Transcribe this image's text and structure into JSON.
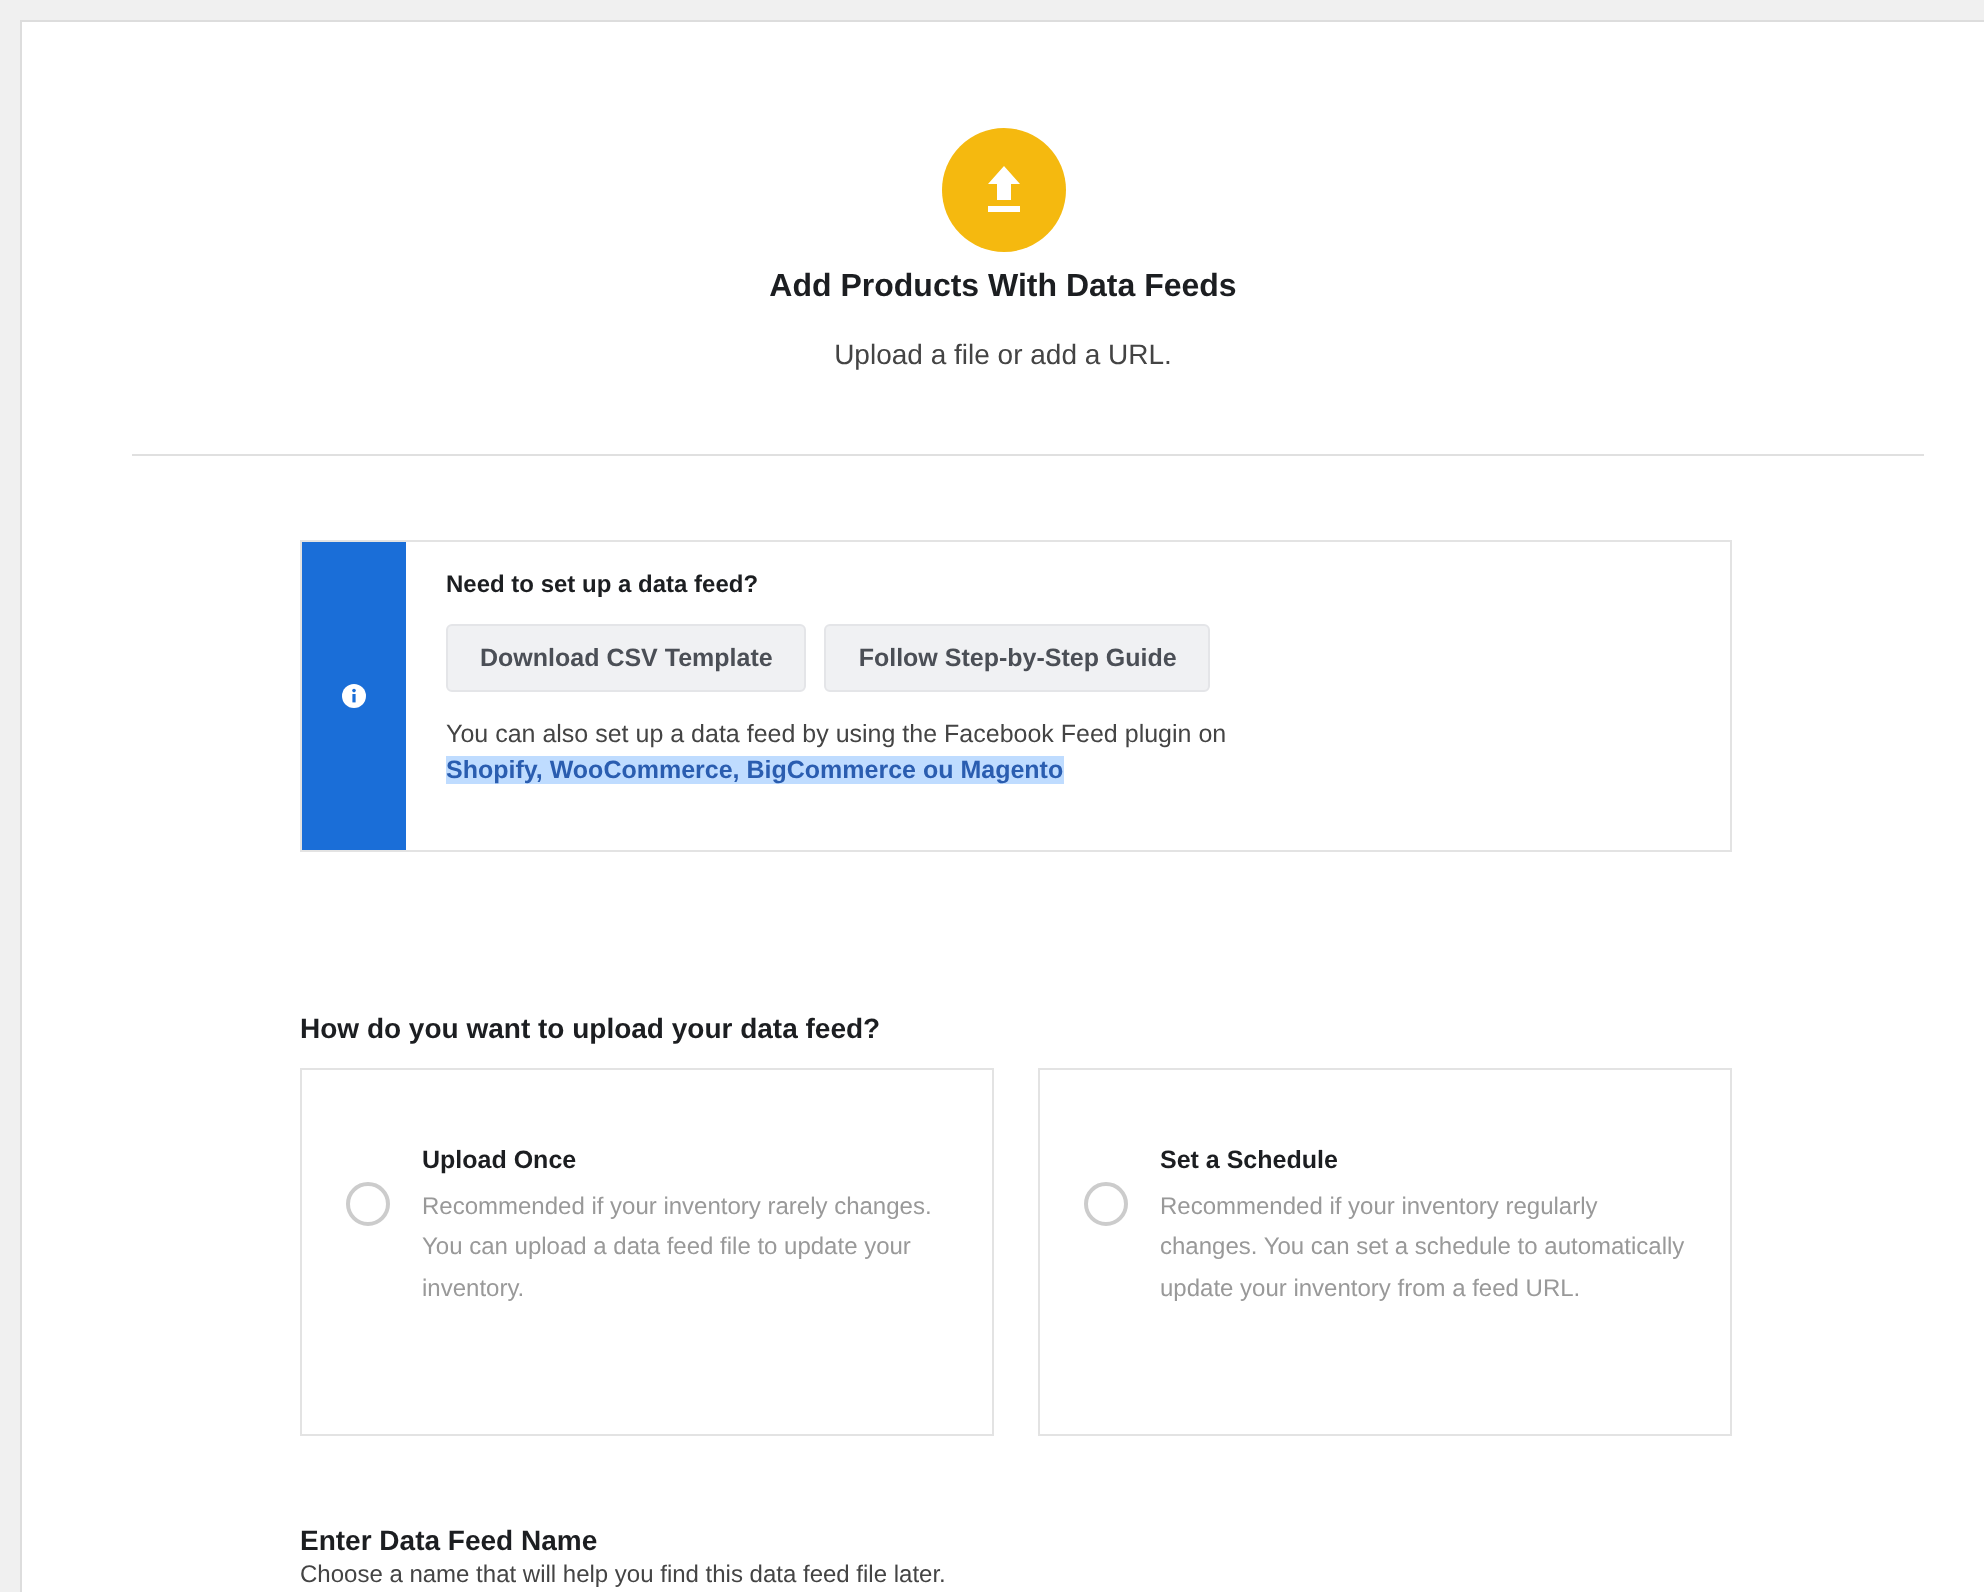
{
  "header": {
    "title": "Add Products With Data Feeds",
    "subtitle": "Upload a file or add a URL."
  },
  "notice": {
    "title": "Need to set up a data feed?",
    "buttons": [
      "Download CSV Template",
      "Follow Step-by-Step Guide"
    ],
    "text": "You can also set up a data feed by using the Facebook Feed plugin on",
    "link": "Shopify, WooCommerce, BigCommerce ou Magento",
    "link_highlighted": true
  },
  "upload_method": {
    "title": "How do you want to upload your data feed?",
    "options": [
      {
        "title": "Upload Once",
        "description": "Recommended if your inventory rarely changes. You can upload a data feed file to update your inventory.",
        "selected": false
      },
      {
        "title": "Set a Schedule",
        "description": "Recommended if your inventory regularly changes. You can set a schedule to automatically update your inventory from a feed URL.",
        "selected": false
      }
    ]
  },
  "feed_name": {
    "title": "Enter Data Feed Name",
    "description": "Choose a name that will help you find this data feed file later."
  }
}
